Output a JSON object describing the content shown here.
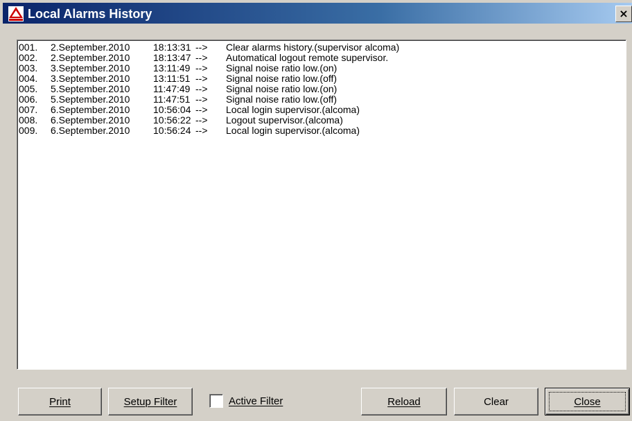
{
  "window": {
    "title": "Local Alarms History",
    "close_glyph": "×",
    "icon": "warning-triangle-icon"
  },
  "log": {
    "rows": [
      {
        "num": "001.",
        "date": "2.September.2010",
        "time": "18:13:31",
        "arrow": "-->",
        "message": "Clear alarms history.(supervisor alcoma)"
      },
      {
        "num": "002.",
        "date": "2.September.2010",
        "time": "18:13:47",
        "arrow": "-->",
        "message": "Automatical logout remote supervisor."
      },
      {
        "num": "003.",
        "date": "3.September.2010",
        "time": "13:11:49",
        "arrow": "-->",
        "message": "Signal noise ratio low.(on)"
      },
      {
        "num": "004.",
        "date": "3.September.2010",
        "time": "13:11:51",
        "arrow": "-->",
        "message": "Signal noise ratio low.(off)"
      },
      {
        "num": "005.",
        "date": "5.September.2010",
        "time": "11:47:49",
        "arrow": "-->",
        "message": "Signal noise ratio low.(on)"
      },
      {
        "num": "006.",
        "date": "5.September.2010",
        "time": "11:47:51",
        "arrow": "-->",
        "message": "Signal noise ratio low.(off)"
      },
      {
        "num": "007.",
        "date": "6.September.2010",
        "time": "10:56:04",
        "arrow": "-->",
        "message": "Local login supervisor.(alcoma)"
      },
      {
        "num": "008.",
        "date": "6.September.2010",
        "time": "10:56:22",
        "arrow": "-->",
        "message": "Logout supervisor.(alcoma)"
      },
      {
        "num": "009.",
        "date": "6.September.2010",
        "time": "10:56:24",
        "arrow": "-->",
        "message": "Local login supervisor.(alcoma)"
      }
    ]
  },
  "buttons": {
    "print": "Print",
    "setup_filter": "Setup Filter",
    "active_filter": "Active Filter",
    "active_filter_checked": false,
    "reload": "Reload",
    "clear": "Clear",
    "close": "Close"
  },
  "colors": {
    "title_start": "#0a246a",
    "title_end": "#a6caf0",
    "face": "#d4d0c8",
    "icon_red": "#cc0000"
  }
}
